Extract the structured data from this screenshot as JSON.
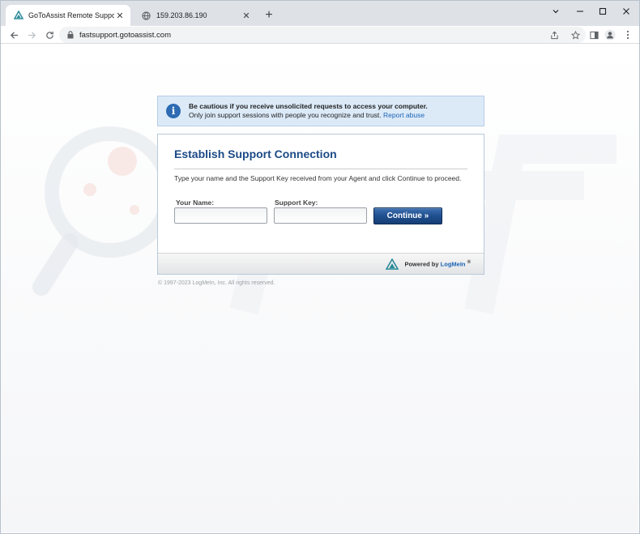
{
  "browser": {
    "tabs": [
      {
        "title": "GoToAssist Remote Support",
        "active": true
      },
      {
        "title": "159.203.86.190",
        "active": false
      }
    ],
    "new_tab_label": "+",
    "url": "fastsupport.gotoassist.com",
    "window_controls": [
      "chevron-down-icon",
      "minimize-icon",
      "maximize-icon",
      "close-icon"
    ]
  },
  "notice": {
    "line1": "Be cautious if you receive unsolicited requests to access your computer.",
    "line2": "Only join support sessions with people you recognize and trust.",
    "link": "Report abuse"
  },
  "card": {
    "title": "Establish Support Connection",
    "instructions": "Type your name and the Support Key received from your Agent and click Continue to proceed.",
    "name_label": "Your Name:",
    "name_value": "",
    "key_label": "Support Key:",
    "key_value": "",
    "continue_label": "Continue »",
    "powered_by": "Powered by",
    "brand": "LogMeIn",
    "registered": "®"
  },
  "copyright": "© 1997-2023 LogMeIn, Inc. All rights reserved.",
  "colors": {
    "title_blue": "#1c4a86",
    "button_blue": "#1f4f8f",
    "link_blue": "#1a64b5",
    "notice_bg": "#dceaf8"
  }
}
